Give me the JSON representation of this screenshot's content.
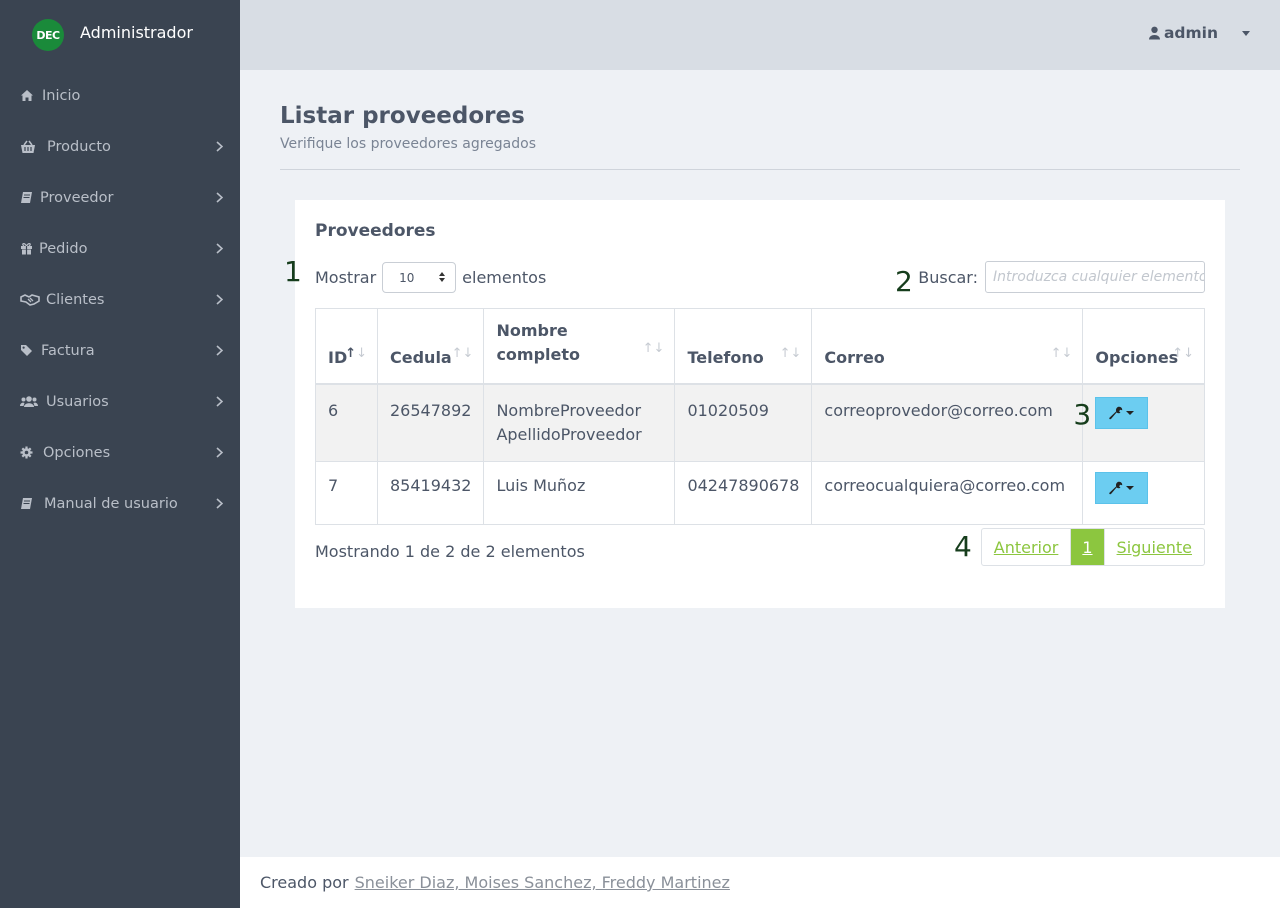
{
  "brand": {
    "logo_text": "DEC",
    "name": "Administrador"
  },
  "sidebar": {
    "items": [
      {
        "label": "Inicio",
        "icon": "home-icon"
      },
      {
        "label": "Producto",
        "icon": "basket-icon"
      },
      {
        "label": "Proveedor",
        "icon": "book-icon"
      },
      {
        "label": "Pedido",
        "icon": "gift-icon"
      },
      {
        "label": "Clientes",
        "icon": "handshake-icon"
      },
      {
        "label": "Factura",
        "icon": "tag-icon"
      },
      {
        "label": "Usuarios",
        "icon": "users-icon"
      },
      {
        "label": "Opciones",
        "icon": "gear-icon"
      },
      {
        "label": "Manual de usuario",
        "icon": "book-icon"
      }
    ]
  },
  "header": {
    "user": "admin"
  },
  "page": {
    "title": "Listar proveedores",
    "subtitle": "Verifique los proveedores agregados"
  },
  "card": {
    "title": "Proveedores",
    "length_prefix": "Mostrar",
    "length_value": "10",
    "length_suffix": "elementos",
    "search_label": "Buscar:",
    "search_placeholder": "Introduzca cualquier elemento"
  },
  "markers": [
    "1",
    "2",
    "3",
    "4"
  ],
  "table": {
    "headers": [
      "ID",
      "Cedula",
      "Nombre completo",
      "Telefono",
      "Correo",
      "Opciones"
    ],
    "rows": [
      {
        "id": "6",
        "cedula": "26547892",
        "nombre": "NombreProveedor ApellidoProveedor",
        "telefono": "01020509",
        "correo": "correoprovedor@correo.com"
      },
      {
        "id": "7",
        "cedula": "85419432",
        "nombre": "Luis Muñoz",
        "telefono": "04247890678",
        "correo": "correocualquiera@correo.com"
      }
    ]
  },
  "info": "Mostrando 1 de 2 de 2 elementos",
  "pagination": {
    "prev": "Anterior",
    "current": "1",
    "next": "Siguiente"
  },
  "footer": {
    "prefix": "Creado por",
    "authors": "Sneiker Diaz, Moises Sanchez, Freddy Martinez"
  },
  "colors": {
    "sidebar": "#3a4451",
    "accent": "#8cc63f",
    "info_button": "#6ccdf1",
    "logo": "#1a8a3a"
  }
}
